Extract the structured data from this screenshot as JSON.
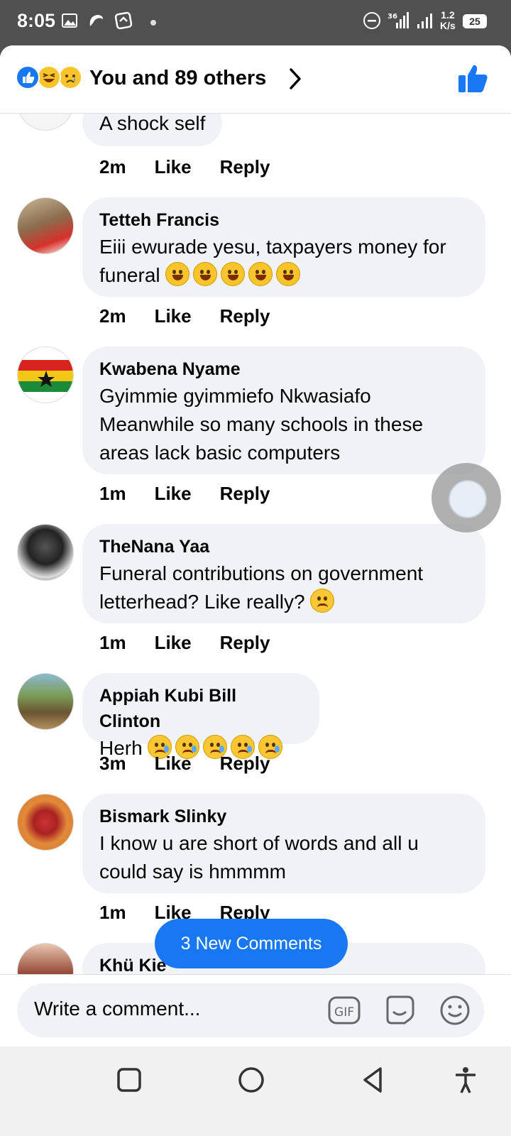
{
  "status_bar": {
    "time": "8:05",
    "network": "36",
    "speed_top": "1.2",
    "speed_bottom": "K/s",
    "battery": "25"
  },
  "header": {
    "reaction_icons": [
      "like-icon",
      "haha-icon",
      "sad-icon"
    ],
    "title": "You and 89 others"
  },
  "comments": [
    {
      "name": "",
      "text": "A shock self",
      "time": "2m",
      "like": "Like",
      "reply": "Reply",
      "emojis": []
    },
    {
      "name": "Tetteh Francis",
      "text": "Eiii ewurade yesu, taxpayers money for funeral",
      "time": "2m",
      "like": "Like",
      "reply": "Reply",
      "emojis": [
        "grin",
        "rofl",
        "joy",
        "laugh",
        "grin"
      ]
    },
    {
      "name": "Kwabena Nyame",
      "text": "Gyimmie gyimmiefo Nkwasiafo Meanwhile so many schools in these areas lack basic computers",
      "time": "1m",
      "like": "Like",
      "reply": "Reply",
      "emojis": []
    },
    {
      "name": "TheNana Yaa",
      "text": "Funeral contributions on government letterhead? Like really?",
      "time": "1m",
      "like": "Like",
      "reply": "Reply",
      "emojis": [
        "pensive"
      ]
    },
    {
      "name": "Appiah Kubi Bill Clinton",
      "text": "Herh",
      "time": "3m",
      "like": "Like",
      "reply": "Reply",
      "emojis": [
        "sad",
        "sad",
        "sad",
        "sad",
        "sad"
      ]
    },
    {
      "name": "Bismark Slinky",
      "text": "I know u are short of words and all u could say is hmmmm",
      "time": "1m",
      "like": "Like",
      "reply": "Reply",
      "emojis": []
    },
    {
      "name": "Khü Kie",
      "text": "",
      "time": "",
      "like": "",
      "reply": "",
      "emojis": []
    }
  ],
  "new_comments_label": "3 New Comments",
  "composer": {
    "placeholder": "Write a comment...",
    "icons": [
      "gif-icon",
      "sticker-icon",
      "emoji-icon"
    ]
  },
  "nav": [
    "recents-icon",
    "home-icon",
    "back-icon",
    "accessibility-icon"
  ],
  "colors": {
    "accent": "#1877f2",
    "bubble": "#f0f2f5"
  }
}
